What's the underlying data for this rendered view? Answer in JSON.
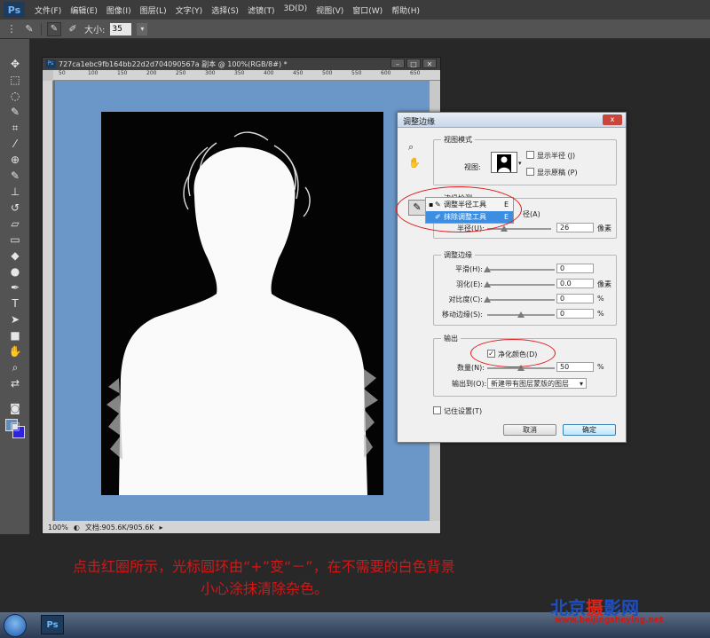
{
  "app": {
    "logo": "Ps",
    "menu": [
      "文件(F)",
      "编辑(E)",
      "图像(I)",
      "图层(L)",
      "文字(Y)",
      "选择(S)",
      "滤镜(T)",
      "3D(D)",
      "视图(V)",
      "窗口(W)",
      "帮助(H)"
    ]
  },
  "options": {
    "size_label": "大小:",
    "size_value": "35"
  },
  "document": {
    "title": "727ca1ebc9fb164bb22d2d704090567a 副本 @ 100%(RGB/8#) *",
    "zoom": "100%",
    "doc_info": "文档:905.6K/905.6K",
    "ruler_ticks": [
      "50",
      "100",
      "150",
      "200",
      "250",
      "300",
      "350",
      "400",
      "450",
      "500",
      "550",
      "600",
      "650"
    ]
  },
  "dialog": {
    "title": "调整边缘",
    "close": "x",
    "view_mode": {
      "title": "视图模式",
      "view_label": "视图:",
      "show_radius": "显示半径 (J)",
      "show_original": "显示原稿 (P)"
    },
    "edge_detection": {
      "title": "边缘检测",
      "smart_radius": "径(A)",
      "radius_label": "半径(U):",
      "radius_value": "26",
      "radius_unit": "像素",
      "radius_fraction": 0.26
    },
    "adjust_edge": {
      "title": "调整边缘",
      "rows": [
        {
          "label": "平滑(H):",
          "value": "0",
          "unit": "",
          "fraction": 0.0
        },
        {
          "label": "羽化(E):",
          "value": "0.0",
          "unit": "像素",
          "fraction": 0.0
        },
        {
          "label": "对比度(C):",
          "value": "0",
          "unit": "%",
          "fraction": 0.0
        },
        {
          "label": "移动边缘(S):",
          "value": "0",
          "unit": "%",
          "fraction": 0.5
        }
      ]
    },
    "output": {
      "title": "输出",
      "decontaminate": "净化颜色(D)",
      "amount_label": "数量(N):",
      "amount_value": "50",
      "amount_unit": "%",
      "amount_fraction": 0.5,
      "output_to_label": "输出到(O):",
      "output_to_value": "新建带有图层蒙版的图层"
    },
    "remember": "记住设置(T)",
    "cancel": "取消",
    "ok": "确定"
  },
  "flyout": {
    "items": [
      {
        "label": "调整半径工具",
        "key": "E"
      },
      {
        "label": "抹除调整工具",
        "key": "E"
      }
    ]
  },
  "caption": {
    "line1": "点击红圈所示，光标圆环由“+”变“－”，在不需要的白色背景",
    "line2": "小心涂抹清除杂色。"
  },
  "watermark": {
    "chars": [
      "北",
      "京",
      "摄",
      "影",
      "网"
    ],
    "colors": [
      "#1f4fbf",
      "#1f4fbf",
      "#d8261b",
      "#1f4fbf",
      "#1f4fbf"
    ],
    "url": "www.beijingsheying.net"
  },
  "colors": {
    "canvas_bg": "#6a96c8",
    "annotation": "#e21b1b",
    "caption": "#d01818"
  }
}
